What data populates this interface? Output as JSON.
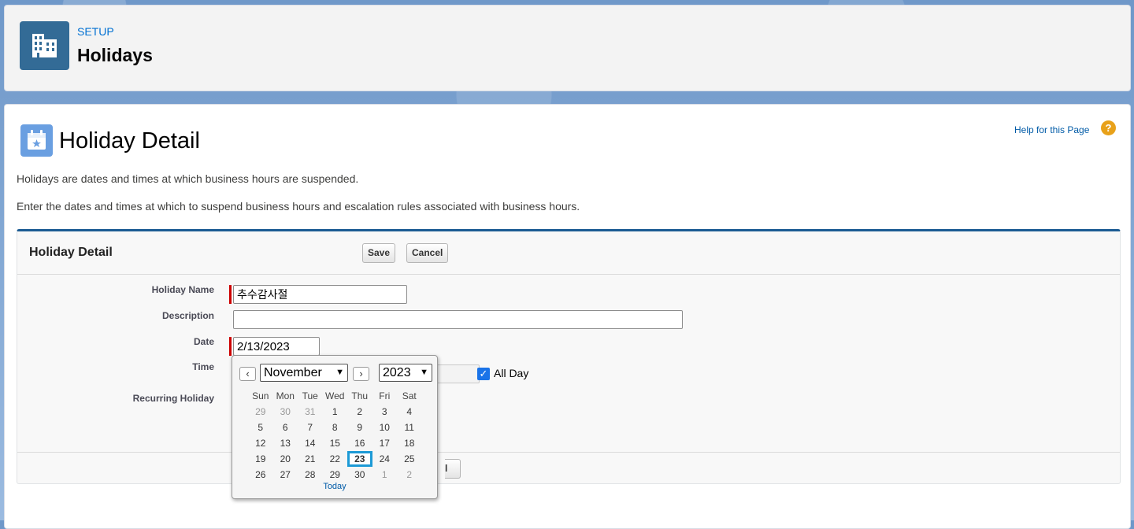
{
  "header": {
    "section": "SETUP",
    "title": "Holidays",
    "icon": "building-icon"
  },
  "page": {
    "title": "Holiday Detail",
    "icon": "calendar-star-icon",
    "help_link": "Help for this Page",
    "help_icon": "question-icon",
    "description1": "Holidays are dates and times at which business hours are suspended.",
    "description2": "Enter the dates and times at which to suspend business hours and escalation rules associated with business hours."
  },
  "detail": {
    "title": "Holiday Detail",
    "save_label": "Save",
    "cancel_label": "Cancel",
    "fields": {
      "name_label": "Holiday Name",
      "name_value": "추수감사절",
      "description_label": "Description",
      "description_value": "",
      "date_label": "Date",
      "date_value": "2/13/2023",
      "time_label": "Time",
      "allday_label": "All Day",
      "allday_checked": true,
      "recurring_label": "Recurring Holiday"
    },
    "footer_button_fragment": "l"
  },
  "datepicker": {
    "prev_label": "‹",
    "next_label": "›",
    "month": "November",
    "year": "2023",
    "weekdays": [
      "Sun",
      "Mon",
      "Tue",
      "Wed",
      "Thu",
      "Fri",
      "Sat"
    ],
    "weeks": [
      [
        "29",
        "30",
        "31",
        "1",
        "2",
        "3",
        "4"
      ],
      [
        "5",
        "6",
        "7",
        "8",
        "9",
        "10",
        "11"
      ],
      [
        "12",
        "13",
        "14",
        "15",
        "16",
        "17",
        "18"
      ],
      [
        "19",
        "20",
        "21",
        "22",
        "23",
        "24",
        "25"
      ],
      [
        "26",
        "27",
        "28",
        "29",
        "30",
        "1",
        "2"
      ]
    ],
    "highlighted_day": "23",
    "today_label": "Today"
  }
}
